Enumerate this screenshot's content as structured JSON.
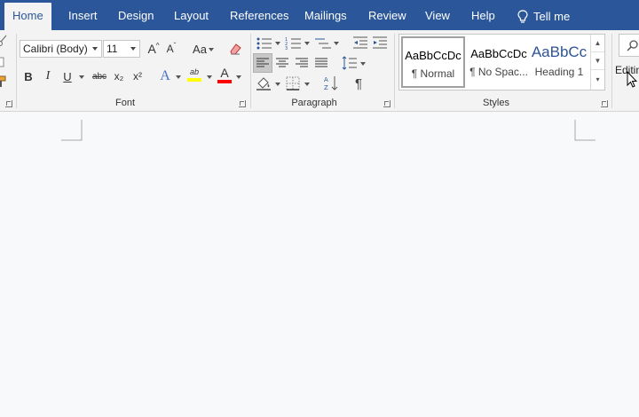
{
  "tabs": [
    {
      "label": "Home",
      "active": true
    },
    {
      "label": "Insert"
    },
    {
      "label": "Design"
    },
    {
      "label": "Layout"
    },
    {
      "label": "References"
    },
    {
      "label": "Mailings"
    },
    {
      "label": "Review"
    },
    {
      "label": "View"
    },
    {
      "label": "Help"
    }
  ],
  "tell_me": {
    "label": "Tell me",
    "icon": "lightbulb-icon"
  },
  "font": {
    "group_label": "Font",
    "font_name": "Calibri (Body)",
    "font_size": "11",
    "grow_label": "A",
    "shrink_label": "A",
    "case_label": "Aa",
    "bold": "B",
    "italic": "I",
    "underline": "U",
    "strike": "abc",
    "subscript": "x₂",
    "superscript": "x²",
    "effects": "A",
    "highlight_label": "ab",
    "font_color_label": "A"
  },
  "paragraph": {
    "group_label": "Paragraph",
    "pilcrow": "¶"
  },
  "styles": {
    "group_label": "Styles",
    "items": [
      {
        "sample": "AaBbCcDc",
        "name": "¶ Normal"
      },
      {
        "sample": "AaBbCcDc",
        "name": "¶ No Spac..."
      },
      {
        "sample": "AaBbCc",
        "name": "Heading 1"
      }
    ]
  },
  "editing": {
    "label": "Editin"
  },
  "colors": {
    "brand": "#2b579a",
    "ribbon": "#f3f3f3",
    "highlight": "#ffff00",
    "font_color": "#ff0000",
    "heading_blue": "#2f5496"
  }
}
